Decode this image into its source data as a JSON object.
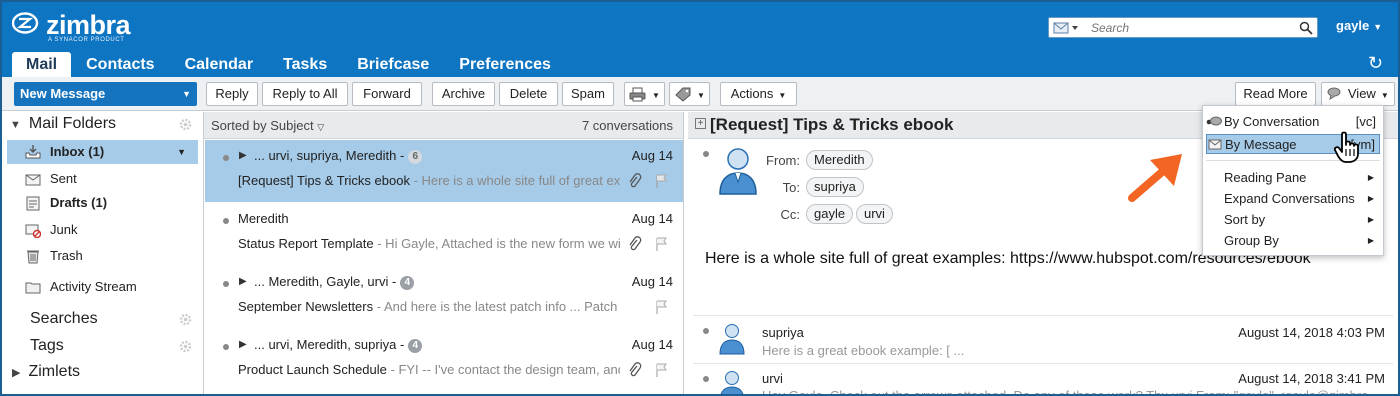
{
  "brand": {
    "name": "zimbra",
    "tagline": "A SYNACOR PRODUCT",
    "primary_color": "#0d75c2",
    "selection_color": "#a6cbe8",
    "accent_arrow_color": "#f26522"
  },
  "search": {
    "placeholder": "Search",
    "type_icon": "envelope-icon"
  },
  "user": {
    "name": "gayle"
  },
  "tabs": [
    {
      "label": "Mail",
      "active": true
    },
    {
      "label": "Contacts"
    },
    {
      "label": "Calendar"
    },
    {
      "label": "Tasks"
    },
    {
      "label": "Briefcase"
    },
    {
      "label": "Preferences"
    }
  ],
  "toolbar": {
    "new_message": "New Message",
    "reply": "Reply",
    "reply_all": "Reply to All",
    "forward": "Forward",
    "archive": "Archive",
    "delete": "Delete",
    "spam": "Spam",
    "actions": "Actions",
    "read_more": "Read More",
    "view": "View"
  },
  "folders": {
    "header": "Mail Folders",
    "items": [
      {
        "label": "Inbox (1)",
        "icon": "inbox-icon",
        "selected": true
      },
      {
        "label": "Sent",
        "icon": "sent-icon"
      },
      {
        "label": "Drafts (1)",
        "icon": "drafts-icon",
        "bold": true
      },
      {
        "label": "Junk",
        "icon": "junk-icon"
      },
      {
        "label": "Trash",
        "icon": "trash-icon"
      },
      {
        "label": "Activity Stream",
        "icon": "folder-icon"
      }
    ],
    "searches": "Searches",
    "tags": "Tags",
    "zimlets": "Zimlets"
  },
  "list": {
    "sort_label": "Sorted by Subject",
    "count_label": "7 conversations",
    "rows": [
      {
        "participants": "... urvi, supriya, Meredith -",
        "count": "6",
        "date": "Aug 14",
        "subject": "[Request] Tips & Tricks ebook",
        "fragment": " - Here is a whole site full of great ex",
        "selected": true,
        "thread": true,
        "attachment": true
      },
      {
        "participants": "Meredith",
        "count": "",
        "date": "Aug 14",
        "subject": "Status Report Template",
        "fragment": " - Hi Gayle, Attached is the new form we wi",
        "thread": false,
        "attachment": true
      },
      {
        "participants": "... Meredith, Gayle, urvi -",
        "count": "4",
        "date": "Aug 14",
        "subject": "September Newsletters",
        "fragment": " - And here is the latest patch info ... Patch Info",
        "thread": true,
        "attachment": false
      },
      {
        "participants": "... urvi, Meredith, supriya -",
        "count": "4",
        "date": "Aug 14",
        "subject": "Product Launch Schedule",
        "fragment": " - FYI -- I've contact the design team, and",
        "thread": true,
        "attachment": true
      }
    ]
  },
  "reader": {
    "subject": "[Request] Tips & Tricks ebook",
    "header_ctrl": "es",
    "from_label": "From:",
    "to_label": "To:",
    "cc_label": "Cc:",
    "from": "Meredith",
    "to": "supriya",
    "cc": [
      "gayle",
      "urvi"
    ],
    "body": "Here is a whole site full of great examples: https://www.hubspot.com/resources/ebook",
    "conversation": [
      {
        "name": "supriya",
        "date": "August 14, 2018 4:03 PM",
        "fragment": "Here is a great ebook example: [ ..."
      },
      {
        "name": "urvi",
        "date": "August 14, 2018 3:41 PM",
        "fragment": "Hey Gayle, Check out the arrows attached. Do any of these work? Thx urvi From: \"gayle\" <gayle@zimbra"
      }
    ]
  },
  "view_menu": {
    "by_conversation": "By Conversation",
    "by_conversation_key": "[vc]",
    "by_message": "By Message",
    "by_message_key": "[vm]",
    "reading_pane": "Reading Pane",
    "expand_conversations": "Expand Conversations",
    "sort_by": "Sort by",
    "group_by": "Group By"
  }
}
